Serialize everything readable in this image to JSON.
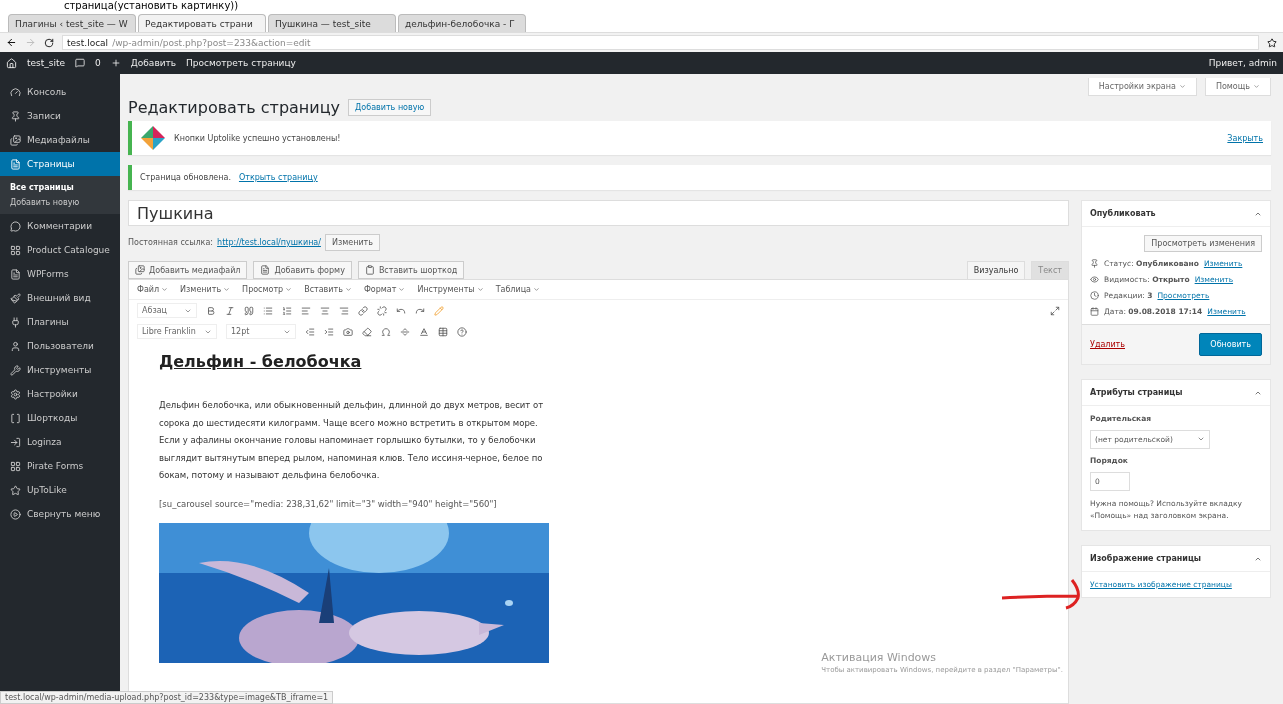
{
  "caption": "страница(установить картинку))",
  "browser": {
    "tabs": [
      {
        "label": "Плагины ‹ test_site — W",
        "selected": false
      },
      {
        "label": "Редактировать страни",
        "selected": true
      },
      {
        "label": "Пушкина — test_site",
        "selected": false
      },
      {
        "label": "дельфин-белобочка - Г",
        "selected": false
      }
    ],
    "address": {
      "host": "test.local",
      "path": "/wp-admin/post.php?post=233&action=edit"
    }
  },
  "admin_bar": {
    "site": "test_site",
    "comments": "0",
    "new": "Добавить",
    "view": "Просмотреть страницу",
    "greeting": "Привет, admin"
  },
  "sidebar": {
    "items": [
      {
        "label": "Консоль",
        "selected": false
      },
      {
        "label": "Записи",
        "selected": false
      },
      {
        "label": "Медиафайлы",
        "selected": false
      },
      {
        "label": "Страницы",
        "selected": true,
        "children": [
          {
            "label": "Все страницы",
            "selected": true
          },
          {
            "label": "Добавить новую",
            "selected": false
          }
        ]
      },
      {
        "label": "Комментарии",
        "selected": false
      },
      {
        "label": "Product Catalogue",
        "selected": false
      },
      {
        "label": "WPForms",
        "selected": false
      },
      {
        "label": "Внешний вид",
        "selected": false
      },
      {
        "label": "Плагины",
        "selected": false
      },
      {
        "label": "Пользователи",
        "selected": false
      },
      {
        "label": "Инструменты",
        "selected": false
      },
      {
        "label": "Настройки",
        "selected": false
      },
      {
        "label": "Шорткоды",
        "selected": false
      },
      {
        "label": "Loginza",
        "selected": false
      },
      {
        "label": "Pirate Forms",
        "selected": false
      },
      {
        "label": "UpToLike",
        "selected": false
      },
      {
        "label": "Свернуть меню",
        "selected": false
      }
    ]
  },
  "screen_options": [
    "Настройки экрана",
    "Помощь"
  ],
  "heading": {
    "title": "Редактировать страницу",
    "add_new": "Добавить новую"
  },
  "notices": [
    {
      "kind": "logo",
      "text": "Кнопки Uptolike успешно установлены!",
      "action": "Закрыть"
    },
    {
      "kind": "plain",
      "text": "Страница обновлена.",
      "link": "Открыть страницу"
    }
  ],
  "post_title": "Пушкина",
  "permalink": {
    "label": "Постоянная ссылка:",
    "url": "http://test.local/пушкина/",
    "button": "Изменить"
  },
  "media_buttons": [
    "Добавить медиафайл",
    "Добавить форму",
    "Вставить шорткод"
  ],
  "editor_tabs": [
    {
      "label": "Визуально",
      "selected": true
    },
    {
      "label": "Текст",
      "selected": false
    }
  ],
  "menubar": [
    "Файл",
    "Изменить",
    "Просмотр",
    "Вставить",
    "Формат",
    "Инструменты",
    "Таблица"
  ],
  "selects": [
    "Абзац",
    "Libre Franklin",
    "12pt"
  ],
  "content": {
    "heading": "Дельфин - белобочка",
    "paragraph": "Дельфин белобочка, или обыкновенный дельфин, длинной до двух метров, весит от сорока до шестидесяти килограмм. Чаще всего можно встретить в открытом море. Если у афалины окончание головы напоминает горлышко бутылки, то у белобочки выглядит вытянутым вперед рылом, напоминая клюв. Тело иссиня-черное, белое по бокам, потому и называют дельфина белобочка.",
    "shortcode": "[su_carousel source=\"media: 238,31,62\" limit=\"3\" width=\"940\" height=\"560\"]"
  },
  "publish": {
    "title": "Опубликовать",
    "preview": "Просмотреть изменения",
    "rows": [
      {
        "label": "Статус:",
        "value": "Опубликовано",
        "link": "Изменить"
      },
      {
        "label": "Видимость:",
        "value": "Открыто",
        "link": "Изменить"
      },
      {
        "label": "Редакции:",
        "value": "3",
        "link": "Просмотреть"
      },
      {
        "label": "Дата:",
        "value": "09.08.2018 17:14",
        "link": "Изменить"
      }
    ],
    "delete": "Удалить",
    "update": "Обновить"
  },
  "attributes": {
    "title": "Атрибуты страницы",
    "parent_label": "Родительская",
    "parent_value": "(нет родительской)",
    "order_label": "Порядок",
    "order_value": "0",
    "help": "Нужна помощь? Используйте вкладку «Помощь» над заголовком экрана."
  },
  "featured_image": {
    "title": "Изображение страницы",
    "link": "Установить изображение страницы"
  },
  "activation": {
    "title": "Активация Windows",
    "text": "Чтобы активировать Windows, перейдите в раздел \"Параметры\"."
  },
  "status_url": "test.local/wp-admin/media-upload.php?post_id=233&type=image&TB_iframe=1"
}
